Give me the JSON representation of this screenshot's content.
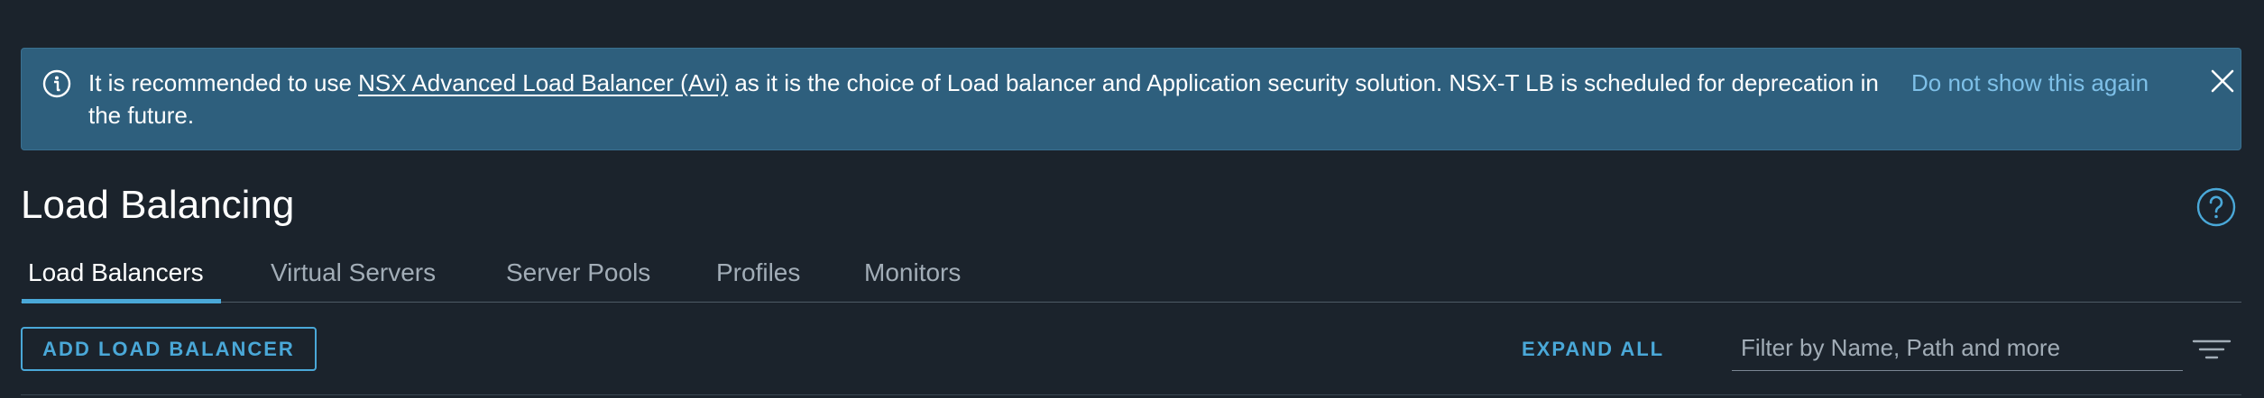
{
  "alert": {
    "icon": "info-icon",
    "text_before": "It is recommended to use ",
    "link_text": "NSX Advanced Load Balancer (Avi)",
    "text_after": " as it is the choice of Load balancer and Application security solution. NSX-T LB is scheduled for deprecation in the future.",
    "dismiss_label": "Do not show this again",
    "close_icon": "close-icon",
    "background": "#2e5f7d",
    "link_color": "#7ec0e8"
  },
  "page": {
    "title": "Load Balancing",
    "help_icon": "help-circle-icon"
  },
  "tabs": [
    {
      "label": "Load Balancers",
      "active": true
    },
    {
      "label": "Virtual Servers",
      "active": false
    },
    {
      "label": "Server Pools",
      "active": false
    },
    {
      "label": "Profiles",
      "active": false
    },
    {
      "label": "Monitors",
      "active": false
    }
  ],
  "toolbar": {
    "add_label": "ADD LOAD BALANCER",
    "expand_label": "EXPAND ALL",
    "filter_placeholder": "Filter by Name, Path and more",
    "filter_icon": "filter-lines-icon",
    "accent": "#4aa8d8"
  }
}
